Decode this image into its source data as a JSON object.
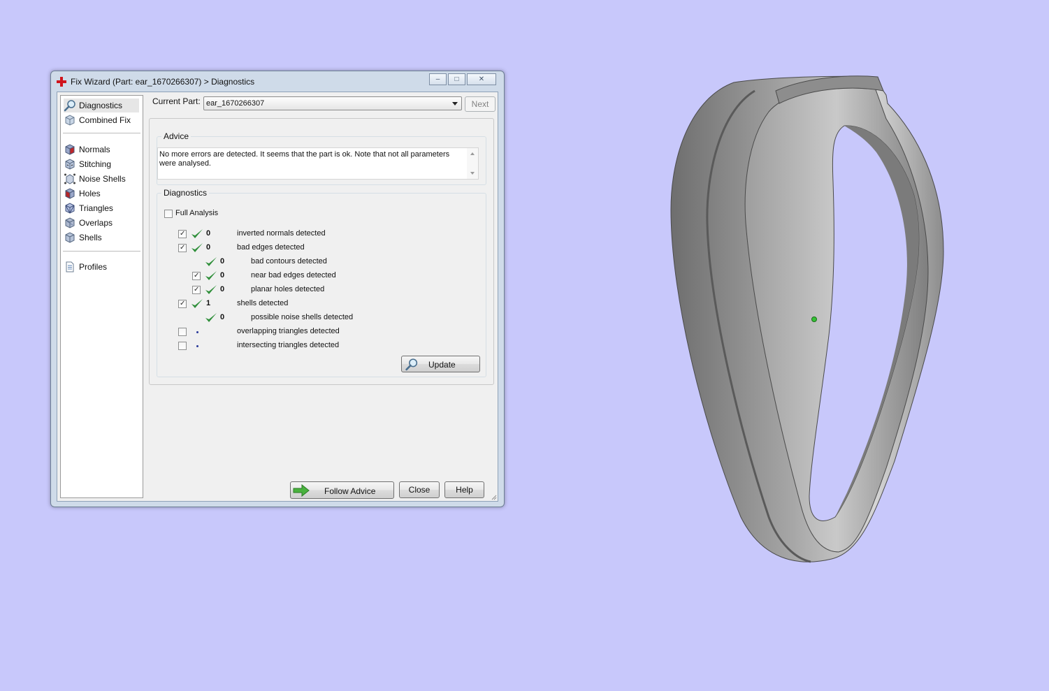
{
  "window": {
    "title": "Fix Wizard (Part: ear_1670266307) > Diagnostics",
    "controls": {
      "minimize": "–",
      "maximize": "□",
      "close": "✕"
    }
  },
  "sidebar": {
    "items": [
      {
        "label": "Diagnostics",
        "icon": "magnifier-icon",
        "selected": true
      },
      {
        "label": "Combined Fix",
        "icon": "cube-icon"
      },
      {
        "label": "Normals",
        "icon": "normals-cube-icon"
      },
      {
        "label": "Stitching",
        "icon": "stitching-cube-icon"
      },
      {
        "label": "Noise Shells",
        "icon": "noise-shells-icon"
      },
      {
        "label": "Holes",
        "icon": "holes-cube-icon"
      },
      {
        "label": "Triangles",
        "icon": "triangles-cube-icon"
      },
      {
        "label": "Overlaps",
        "icon": "overlaps-cube-icon"
      },
      {
        "label": "Shells",
        "icon": "shells-cube-icon"
      },
      {
        "label": "Profiles",
        "icon": "document-icon"
      }
    ]
  },
  "header": {
    "current_part_label": "Current Part:",
    "current_part_value": "ear_1670266307",
    "next_label": "Next"
  },
  "advice": {
    "title": "Advice",
    "text": "No more errors are detected. It seems that the part is ok. Note that not all parameters were analysed."
  },
  "diagnostics": {
    "title": "Diagnostics",
    "full_analysis_label": "Full Analysis",
    "full_analysis_checked": false,
    "rows": [
      {
        "count": "0",
        "label": "inverted normals detected",
        "checked": true,
        "status": "ok",
        "indent": 0
      },
      {
        "count": "0",
        "label": "bad edges detected",
        "checked": true,
        "status": "ok",
        "indent": 0
      },
      {
        "count": "0",
        "label": "bad contours detected",
        "checked": null,
        "status": "ok",
        "indent": 1
      },
      {
        "count": "0",
        "label": "near bad edges detected",
        "checked": true,
        "status": "ok",
        "indent": 1
      },
      {
        "count": "0",
        "label": "planar holes detected",
        "checked": true,
        "status": "ok",
        "indent": 1
      },
      {
        "count": "1",
        "label": "shells detected",
        "checked": true,
        "status": "ok",
        "indent": 0
      },
      {
        "count": "0",
        "label": "possible noise shells detected",
        "checked": null,
        "status": "ok",
        "indent": 1
      },
      {
        "count": "",
        "label": "overlapping triangles detected",
        "checked": false,
        "status": "pending",
        "indent": 0
      },
      {
        "count": "",
        "label": "intersecting triangles detected",
        "checked": false,
        "status": "pending",
        "indent": 0
      }
    ],
    "update_label": "Update"
  },
  "footer": {
    "follow_advice_label": "Follow Advice",
    "close_label": "Close",
    "help_label": "Help"
  },
  "colors": {
    "background": "#c8c8fb",
    "model_gray": "#8a8a8a",
    "ok_green": "#2f8f3a",
    "pivot_green": "#35c135"
  }
}
